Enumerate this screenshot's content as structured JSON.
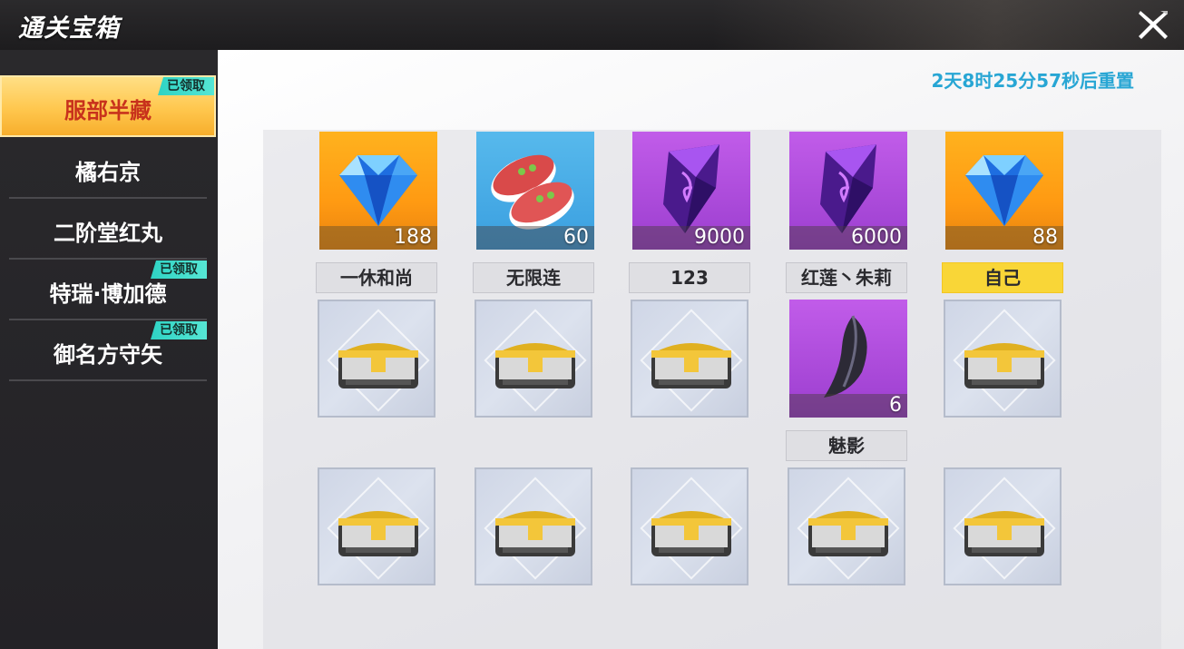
{
  "header": {
    "title": "通关宝箱",
    "close_icon": "close-x-icon"
  },
  "sidebar": {
    "items": [
      {
        "label": "服部半藏",
        "active": true,
        "badge": "已领取"
      },
      {
        "label": "橘右京",
        "active": false,
        "badge": ""
      },
      {
        "label": "二阶堂红丸",
        "active": false,
        "badge": ""
      },
      {
        "label": "特瑞·博加德",
        "active": false,
        "badge": "已领取"
      },
      {
        "label": "御名方守矢",
        "active": false,
        "badge": "已领取"
      }
    ]
  },
  "main": {
    "timer": "2天8时25分57秒后重置",
    "rewards": [
      {
        "item_icon": "blue-diamond-icon",
        "rarity": "gold",
        "qty": "188",
        "player": "一休和尚"
      },
      {
        "item_icon": "sushi-icon",
        "rarity": "blue",
        "qty": "60",
        "player": "无限连"
      },
      {
        "item_icon": "purple-crystal-icon",
        "rarity": "purple",
        "qty": "9000",
        "player": "123"
      },
      {
        "item_icon": "purple-crystal-icon",
        "rarity": "purple",
        "qty": "6000",
        "player": "红莲丶朱莉"
      },
      {
        "item_icon": "blue-diamond-icon",
        "rarity": "gold",
        "qty": "88",
        "player": "自己"
      }
    ],
    "row2_special": {
      "item_icon": "dark-feather-icon",
      "rarity": "purple",
      "qty": "6",
      "player": "魅影"
    }
  },
  "colors": {
    "timer": "#28a6d4",
    "claimed_badge": "#2fd3c4",
    "active_tab": "#ffc74e",
    "self_name": "#f9d637"
  }
}
